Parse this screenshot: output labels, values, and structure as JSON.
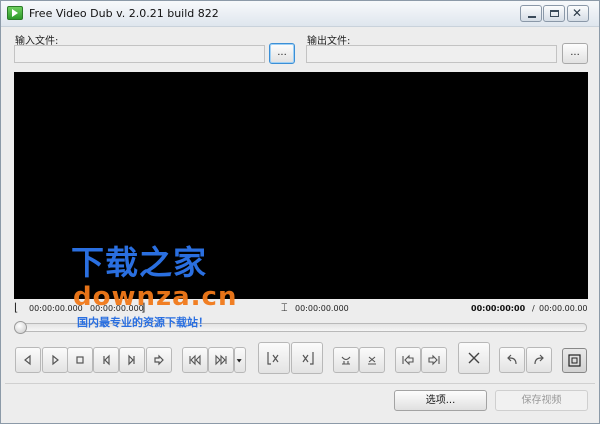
{
  "window": {
    "title": "Free Video Dub  v. 2.0.21 build 822",
    "icon": "film-play-icon"
  },
  "files": {
    "input_label": "输入文件:",
    "output_label": "输出文件:",
    "input_value": "",
    "output_value": "",
    "browse_label": "..."
  },
  "timeline": {
    "start": "00:00:00.000",
    "mid": "00:00:00.000",
    "cursor": "00:00:00.000",
    "current": "00:00:00:00",
    "separator": "/",
    "total": "00:00.00.00",
    "seek_position": 0
  },
  "toolbar": {
    "icons": [
      "prev-frame-icon",
      "play-icon",
      "stop-icon",
      "skip-start-icon",
      "skip-end-icon",
      "next-frame-icon",
      "go-start-icon",
      "go-end-icon",
      "dropdown-arrow-icon",
      "mark-in-icon",
      "mark-out-icon",
      "scissors-icon",
      "delete-selection-icon",
      "prev-keyframe-icon",
      "next-keyframe-icon",
      "cancel-icon",
      "undo-icon",
      "redo-icon",
      "fullscreen-icon"
    ]
  },
  "buttons": {
    "options": "选项...",
    "save": "保存视频"
  },
  "watermark": {
    "cn": "下载之家",
    "domain": "downza.cn",
    "tagline": "国内最专业的资源下载站！"
  }
}
